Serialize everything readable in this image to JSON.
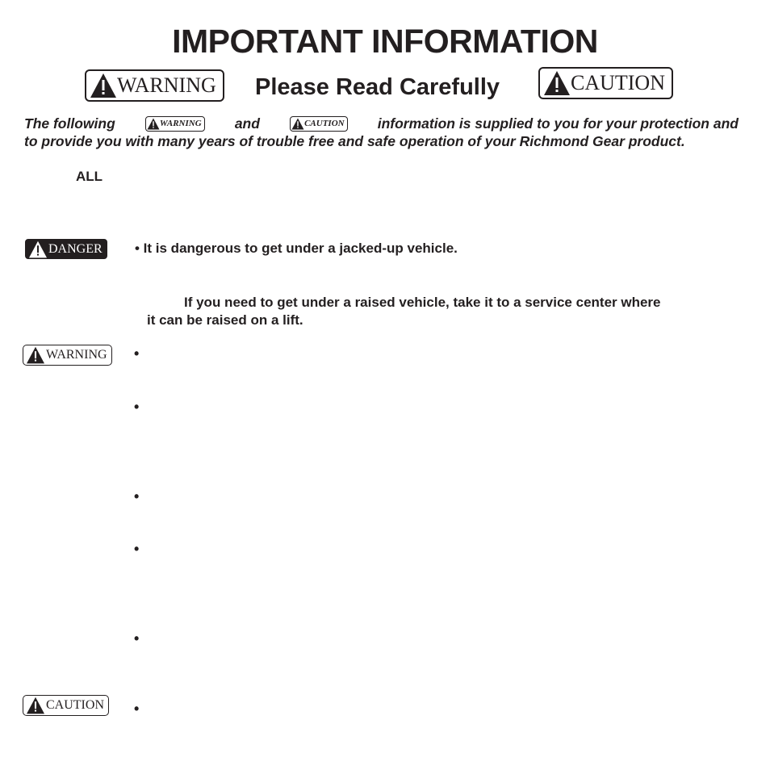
{
  "header": {
    "title": "IMPORTANT INFORMATION",
    "subtitle": "Please Read Carefully",
    "warning_label": "WARNING",
    "caution_label": "CAUTION"
  },
  "intro": {
    "part1": "The following",
    "warning_label": "WARNING",
    "part2": "and",
    "caution_label": "CAUTION",
    "part3": "information is supplied to you for your protection and",
    "line2": "to provide you with many years of trouble free and safe operation of your Richmond Gear product."
  },
  "all_label": "ALL",
  "danger": {
    "label": "DANGER",
    "bullet": "• It is dangerous to get under a jacked-up vehicle.",
    "line2": "If you need to get under a raised vehicle, take it to a service center where",
    "line3": "it can be raised on a lift."
  },
  "warning_section": {
    "label": "WARNING",
    "bullet": "•"
  },
  "caution_section": {
    "label": "CAUTION",
    "bullet": "•"
  },
  "icons": {
    "alert": "warning-triangle-icon"
  }
}
